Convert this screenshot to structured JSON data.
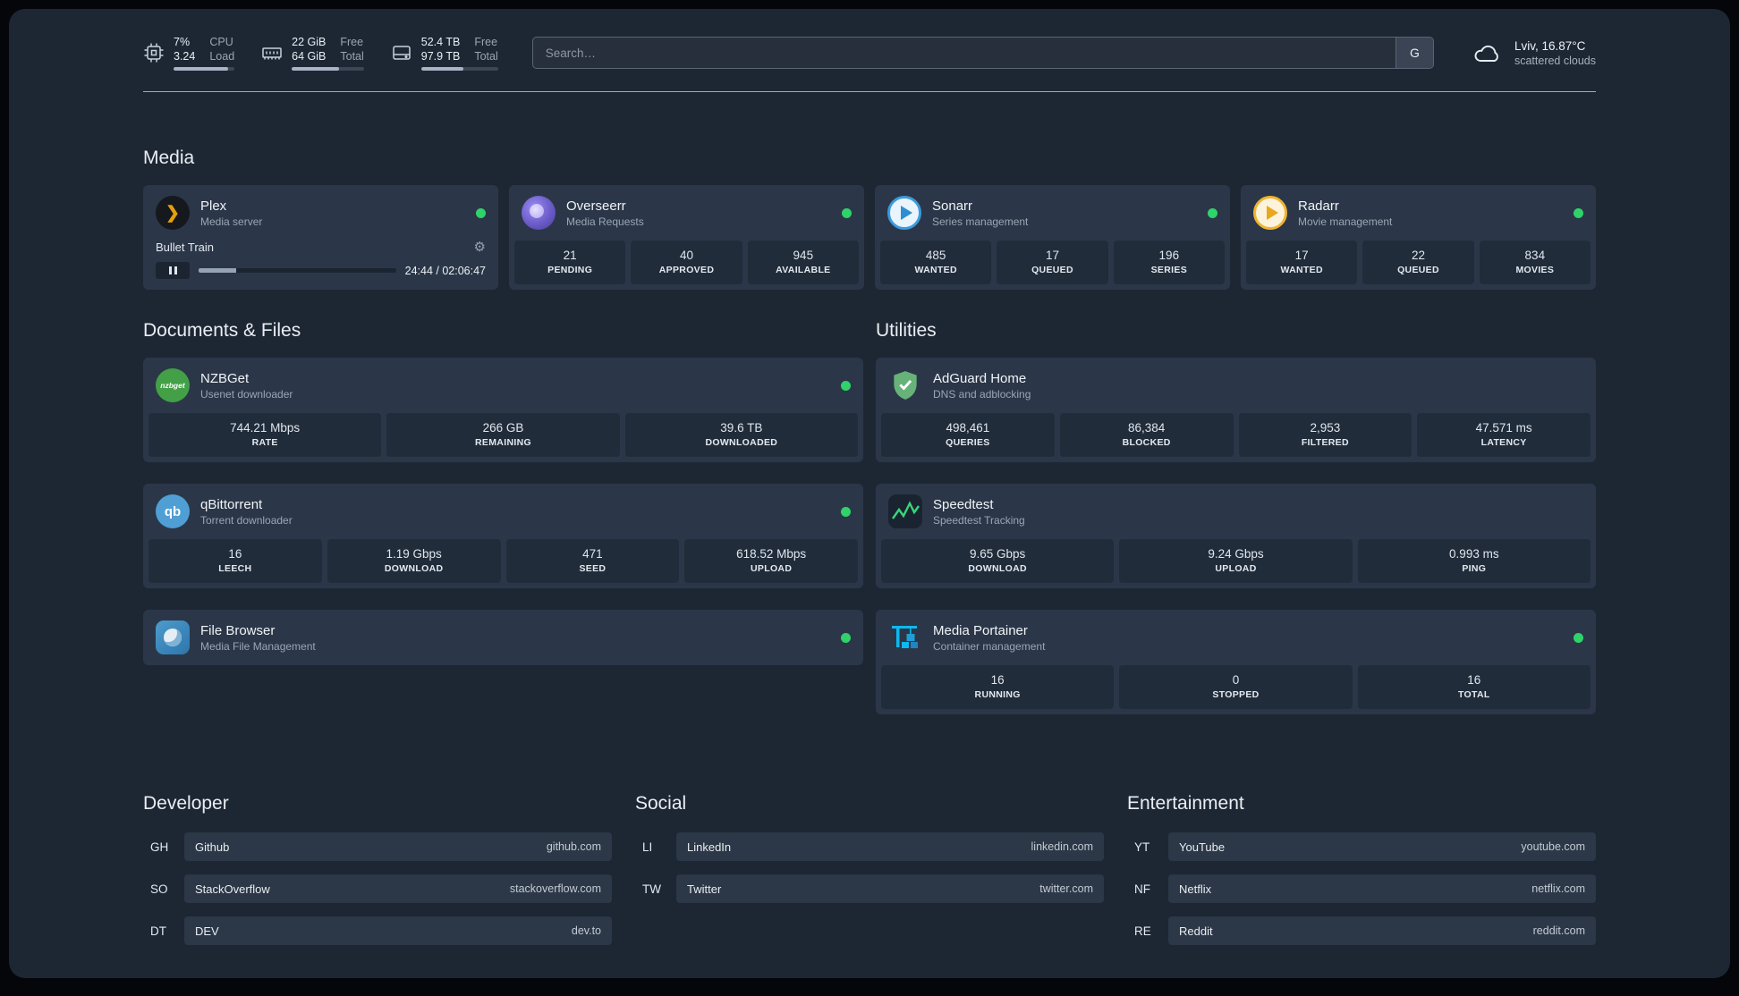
{
  "colors": {
    "background": "#1d2734",
    "card": "#2b3748",
    "tile": "#212c3a",
    "status_green": "#2fd36a",
    "plex_orange": "#e5a00d",
    "sonarr_blue": "#3a9bdc",
    "radarr_gold": "#f0b42e",
    "adguard_green": "#67b279",
    "portainer_blue": "#0db9f0"
  },
  "icons": {
    "gear": "⚙",
    "plex_chevron": "❯"
  },
  "topbar": {
    "cpu": {
      "values": [
        "7%",
        "3.24"
      ],
      "labels": [
        "CPU",
        "Load"
      ]
    },
    "memory": {
      "values": [
        "22 GiB",
        "64 GiB"
      ],
      "labels": [
        "Free",
        "Total"
      ]
    },
    "disk": {
      "values": [
        "52.4 TB",
        "97.9 TB"
      ],
      "labels": [
        "Free",
        "Total"
      ]
    },
    "search": {
      "placeholder": "Search…",
      "button_label": "G"
    },
    "weather": {
      "location": "Lviv, 16.87°C",
      "condition": "scattered clouds"
    }
  },
  "sections": {
    "media": {
      "title": "Media"
    },
    "documents": {
      "title": "Documents & Files"
    },
    "utilities": {
      "title": "Utilities"
    },
    "developer": {
      "title": "Developer"
    },
    "social": {
      "title": "Social"
    },
    "entertainment": {
      "title": "Entertainment"
    }
  },
  "services": {
    "plex": {
      "name": "Plex",
      "description": "Media server",
      "player": {
        "track": "Bullet Train",
        "time": "24:44 / 02:06:47",
        "progress_percent": 19
      }
    },
    "overseerr": {
      "name": "Overseerr",
      "description": "Media Requests",
      "stats": [
        {
          "value": "21",
          "label": "PENDING"
        },
        {
          "value": "40",
          "label": "APPROVED"
        },
        {
          "value": "945",
          "label": "AVAILABLE"
        }
      ]
    },
    "sonarr": {
      "name": "Sonarr",
      "description": "Series management",
      "stats": [
        {
          "value": "485",
          "label": "WANTED"
        },
        {
          "value": "17",
          "label": "QUEUED"
        },
        {
          "value": "196",
          "label": "SERIES"
        }
      ]
    },
    "radarr": {
      "name": "Radarr",
      "description": "Movie management",
      "stats": [
        {
          "value": "17",
          "label": "WANTED"
        },
        {
          "value": "22",
          "label": "QUEUED"
        },
        {
          "value": "834",
          "label": "MOVIES"
        }
      ]
    },
    "nzbget": {
      "name": "NZBGet",
      "description": "Usenet downloader",
      "icon_text": "nzbget",
      "stats": [
        {
          "value": "744.21 Mbps",
          "label": "RATE"
        },
        {
          "value": "266 GB",
          "label": "REMAINING"
        },
        {
          "value": "39.6 TB",
          "label": "DOWNLOADED"
        }
      ]
    },
    "qbittorrent": {
      "name": "qBittorrent",
      "description": "Torrent downloader",
      "icon_text": "qb",
      "stats": [
        {
          "value": "16",
          "label": "LEECH"
        },
        {
          "value": "1.19 Gbps",
          "label": "DOWNLOAD"
        },
        {
          "value": "471",
          "label": "SEED"
        },
        {
          "value": "618.52 Mbps",
          "label": "UPLOAD"
        }
      ]
    },
    "filebrowser": {
      "name": "File Browser",
      "description": "Media File Management"
    },
    "adguard": {
      "name": "AdGuard Home",
      "description": "DNS and adblocking",
      "stats": [
        {
          "value": "498,461",
          "label": "QUERIES"
        },
        {
          "value": "86,384",
          "label": "BLOCKED"
        },
        {
          "value": "2,953",
          "label": "FILTERED"
        },
        {
          "value": "47.571 ms",
          "label": "LATENCY"
        }
      ]
    },
    "speedtest": {
      "name": "Speedtest",
      "description": "Speedtest Tracking",
      "stats": [
        {
          "value": "9.65 Gbps",
          "label": "DOWNLOAD"
        },
        {
          "value": "9.24 Gbps",
          "label": "UPLOAD"
        },
        {
          "value": "0.993 ms",
          "label": "PING"
        }
      ]
    },
    "portainer": {
      "name": "Media Portainer",
      "description": "Container management",
      "stats": [
        {
          "value": "16",
          "label": "RUNNING"
        },
        {
          "value": "0",
          "label": "STOPPED"
        },
        {
          "value": "16",
          "label": "TOTAL"
        }
      ]
    }
  },
  "bookmarks": {
    "developer": [
      {
        "abbr": "GH",
        "name": "Github",
        "url": "github.com"
      },
      {
        "abbr": "SO",
        "name": "StackOverflow",
        "url": "stackoverflow.com"
      },
      {
        "abbr": "DT",
        "name": "DEV",
        "url": "dev.to"
      }
    ],
    "social": [
      {
        "abbr": "LI",
        "name": "LinkedIn",
        "url": "linkedin.com"
      },
      {
        "abbr": "TW",
        "name": "Twitter",
        "url": "twitter.com"
      }
    ],
    "entertainment": [
      {
        "abbr": "YT",
        "name": "YouTube",
        "url": "youtube.com"
      },
      {
        "abbr": "NF",
        "name": "Netflix",
        "url": "netflix.com"
      },
      {
        "abbr": "RE",
        "name": "Reddit",
        "url": "reddit.com"
      }
    ]
  }
}
